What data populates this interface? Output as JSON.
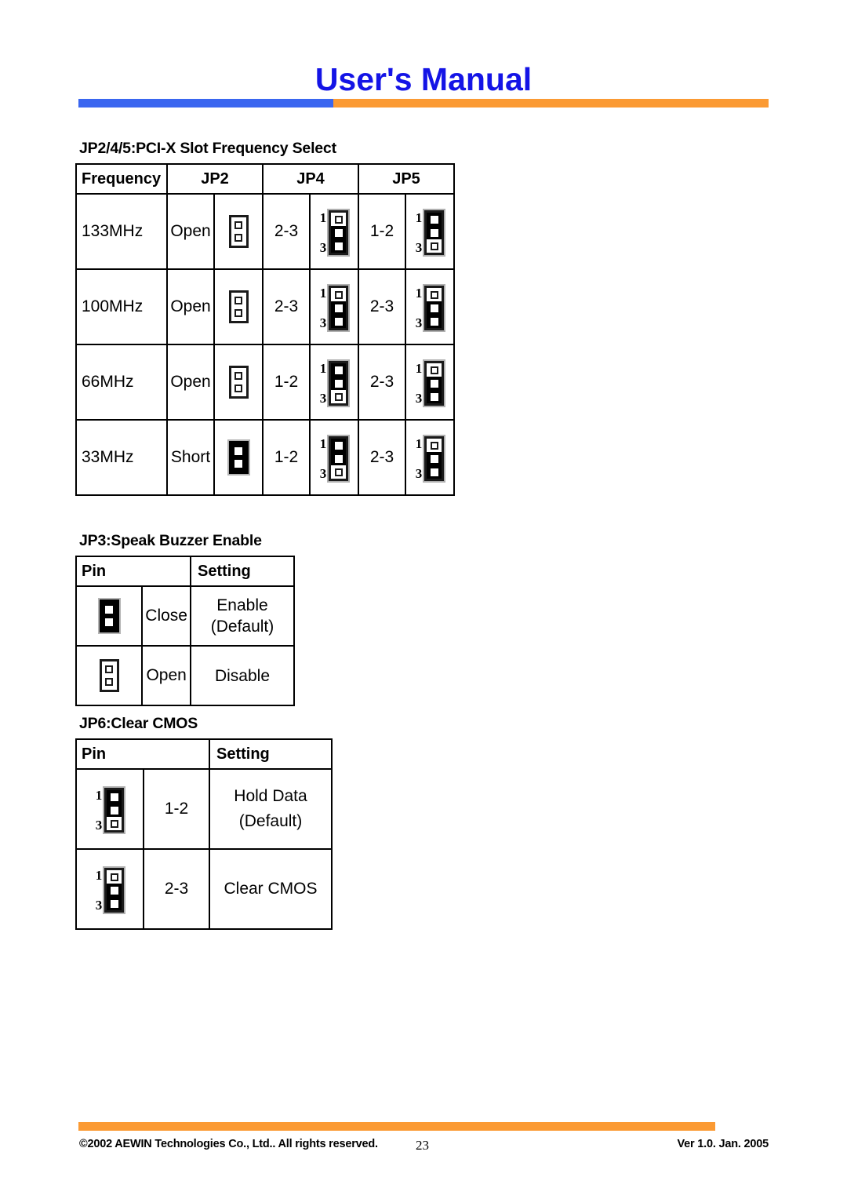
{
  "document": {
    "title": "User's Manual",
    "title_color": "#1414e6",
    "rule_blue": "#3a66f0",
    "rule_orange": "#fb9a33"
  },
  "freq_section": {
    "heading": "JP2/4/5:PCI-X Slot Frequency Select",
    "headers": [
      "Frequency",
      "JP2",
      "JP4",
      "JP5"
    ],
    "rows": [
      {
        "frequency": "133MHz",
        "jp2_state": "Open",
        "jp2_jumper": "open2",
        "jp4_state": "2-3",
        "jp4_jumper": "cap23",
        "jp5_state": "1-2",
        "jp5_jumper": "cap12"
      },
      {
        "frequency": "100MHz",
        "jp2_state": "Open",
        "jp2_jumper": "open2",
        "jp4_state": "2-3",
        "jp4_jumper": "cap23",
        "jp5_state": "2-3",
        "jp5_jumper": "cap23"
      },
      {
        "frequency": "66MHz",
        "jp2_state": "Open",
        "jp2_jumper": "open2",
        "jp4_state": "1-2",
        "jp4_jumper": "cap12",
        "jp5_state": "2-3",
        "jp5_jumper": "cap23"
      },
      {
        "frequency": "33MHz",
        "jp2_state": "Short",
        "jp2_jumper": "short2",
        "jp4_state": "1-2",
        "jp4_jumper": "cap12",
        "jp5_state": "2-3",
        "jp5_jumper": "cap23"
      }
    ]
  },
  "jp3_section": {
    "heading": "JP3:Speak Buzzer Enable",
    "headers": [
      "Pin",
      "Setting"
    ],
    "rows": [
      {
        "jumper": "short2",
        "state": "Close",
        "setting_line1": "Enable",
        "setting_line2": "(Default)"
      },
      {
        "jumper": "open2",
        "state": "Open",
        "setting_line1": "Disable",
        "setting_line2": ""
      }
    ]
  },
  "jp6_section": {
    "heading": "JP6:Clear CMOS",
    "headers": [
      "Pin",
      "Setting"
    ],
    "rows": [
      {
        "jumper": "cap12",
        "state": "1-2",
        "setting_line1": "Hold Data",
        "setting_line2": "(Default)"
      },
      {
        "jumper": "cap23",
        "state": "2-3",
        "setting_line1": "Clear CMOS",
        "setting_line2": ""
      }
    ]
  },
  "pin_labels": {
    "top": "1",
    "bottom": "3"
  },
  "footer": {
    "copyright": "©2002 AEWIN Technologies Co., Ltd.. All rights reserved.",
    "page_number": "23",
    "version": "Ver 1.0. Jan. 2005"
  }
}
